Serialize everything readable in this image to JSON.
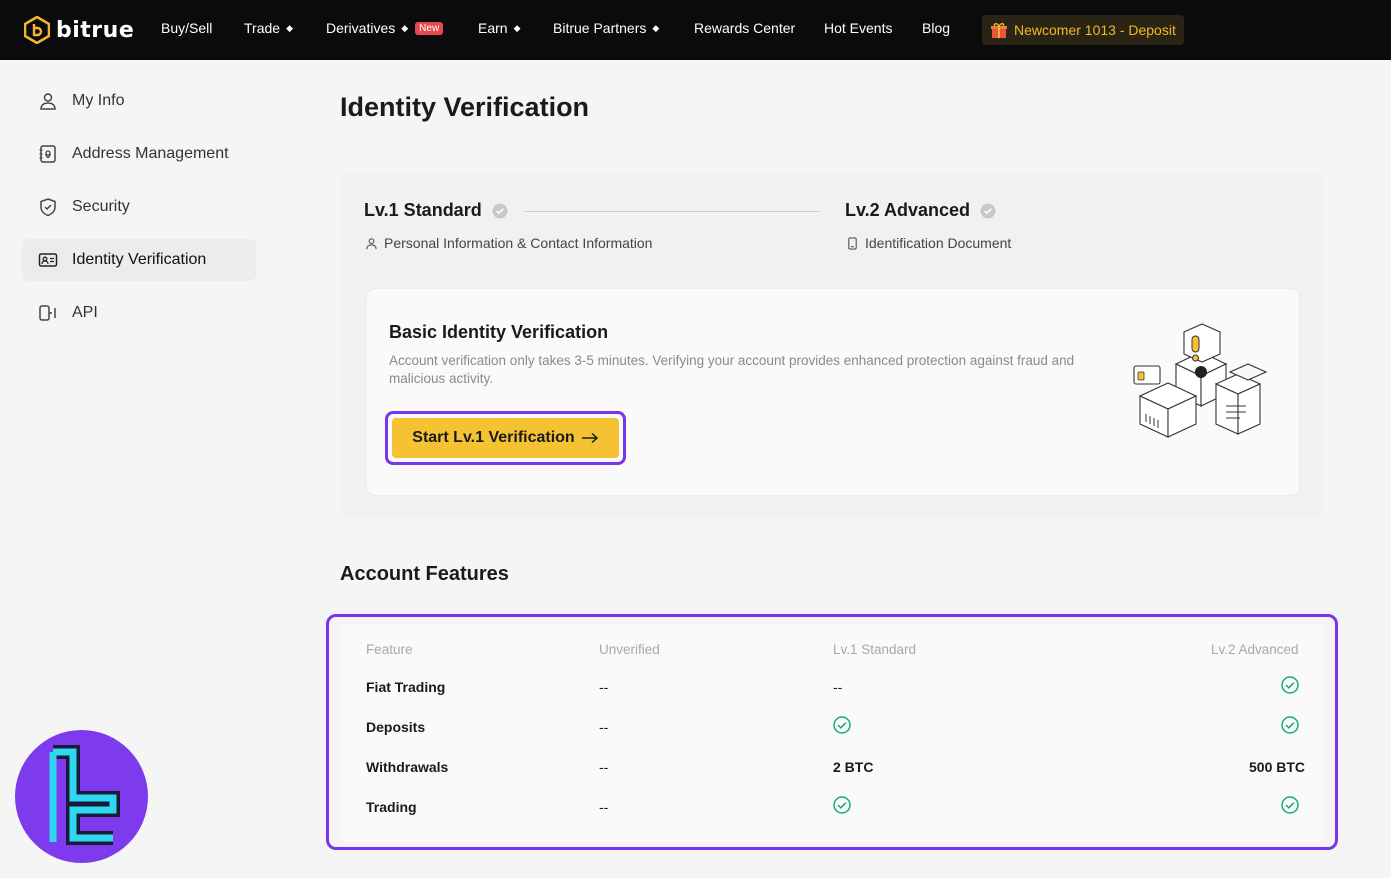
{
  "brand": {
    "name": "bitrue"
  },
  "nav": {
    "items": [
      {
        "label": "Buy/Sell",
        "caret": false
      },
      {
        "label": "Trade",
        "caret": true
      },
      {
        "label": "Derivatives",
        "caret": true,
        "badge": "New"
      },
      {
        "label": "Earn",
        "caret": true
      },
      {
        "label": "Bitrue Partners",
        "caret": true
      },
      {
        "label": "Rewards Center",
        "caret": false
      },
      {
        "label": "Hot Events",
        "caret": false
      },
      {
        "label": "Blog",
        "caret": false
      }
    ],
    "promo": "Newcomer 1013 - Deposit"
  },
  "sidebar": {
    "items": [
      {
        "label": "My Info",
        "icon": "user-icon"
      },
      {
        "label": "Address Management",
        "icon": "address-book-icon"
      },
      {
        "label": "Security",
        "icon": "shield-icon"
      },
      {
        "label": "Identity Verification",
        "icon": "id-card-icon",
        "active": true
      },
      {
        "label": "API",
        "icon": "api-icon"
      }
    ]
  },
  "page": {
    "title": "Identity Verification"
  },
  "levels": {
    "lv1": {
      "title": "Lv.1 Standard",
      "subtitle": "Personal Information & Contact Information"
    },
    "lv2": {
      "title": "Lv.2 Advanced",
      "subtitle": "Identification Document"
    }
  },
  "basic": {
    "title": "Basic Identity Verification",
    "description": "Account verification only takes 3-5 minutes. Verifying your account provides enhanced protection against fraud and malicious activity.",
    "button_label": "Start Lv.1 Verification"
  },
  "features": {
    "title": "Account Features",
    "headers": [
      "Feature",
      "Unverified",
      "Lv.1 Standard",
      "Lv.2 Advanced"
    ],
    "rows": [
      {
        "feature": "Fiat Trading",
        "unverified": "--",
        "lv1": "--",
        "lv2": "check"
      },
      {
        "feature": "Deposits",
        "unverified": "--",
        "lv1": "check",
        "lv2": "check"
      },
      {
        "feature": "Withdrawals",
        "unverified": "--",
        "lv1": "2 BTC",
        "lv2": "500 BTC"
      },
      {
        "feature": "Trading",
        "unverified": "--",
        "lv1": "check",
        "lv2": "check"
      }
    ]
  },
  "colors": {
    "accent_yellow": "#f5c232",
    "highlight_purple": "#7b35e8",
    "check_green": "#18a874",
    "nav_bg": "#0b0b0d"
  }
}
